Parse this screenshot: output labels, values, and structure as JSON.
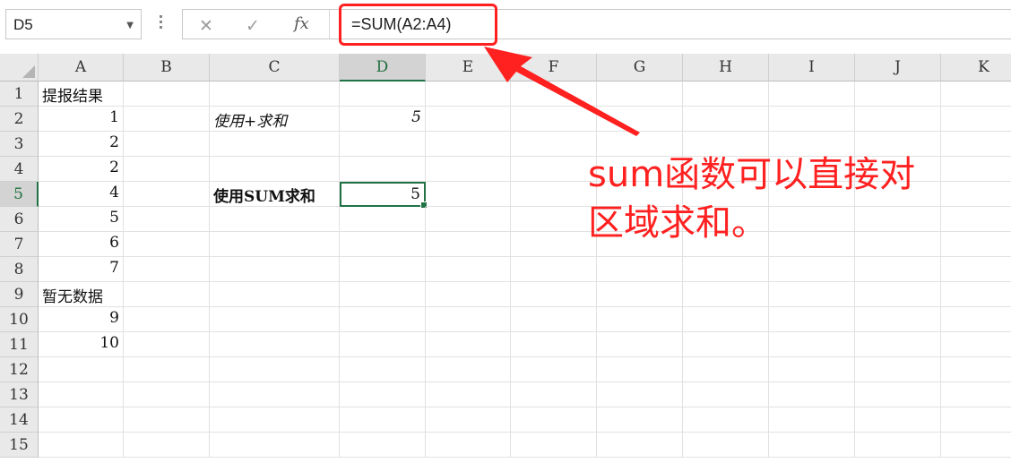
{
  "name_box": "D5",
  "formula_bar": {
    "cancel_icon": "✕",
    "enter_icon": "✓",
    "fx_label": "fx",
    "formula": "=SUM(A2:A4)"
  },
  "columns": [
    "A",
    "B",
    "C",
    "D",
    "E",
    "F",
    "G",
    "H",
    "I",
    "J",
    "K"
  ],
  "selected_column": "D",
  "rows": [
    "1",
    "2",
    "3",
    "4",
    "5",
    "6",
    "7",
    "8",
    "9",
    "10",
    "11",
    "12",
    "13",
    "14",
    "15"
  ],
  "selected_row": "5",
  "cells": {
    "A1": "提报结果",
    "A2": "1",
    "A3": "2",
    "A4": "2",
    "A5": "4",
    "A6": "5",
    "A7": "6",
    "A8": "7",
    "A9": "暂无数据",
    "A10": "9",
    "A11": "10",
    "C2": "使用+求和",
    "D2": "5",
    "C5": "使用SUM求和",
    "D5": "5"
  },
  "annotation": {
    "line1": "sum函数可以直接对",
    "line2": "区域求和。",
    "color": "#ff2020"
  }
}
